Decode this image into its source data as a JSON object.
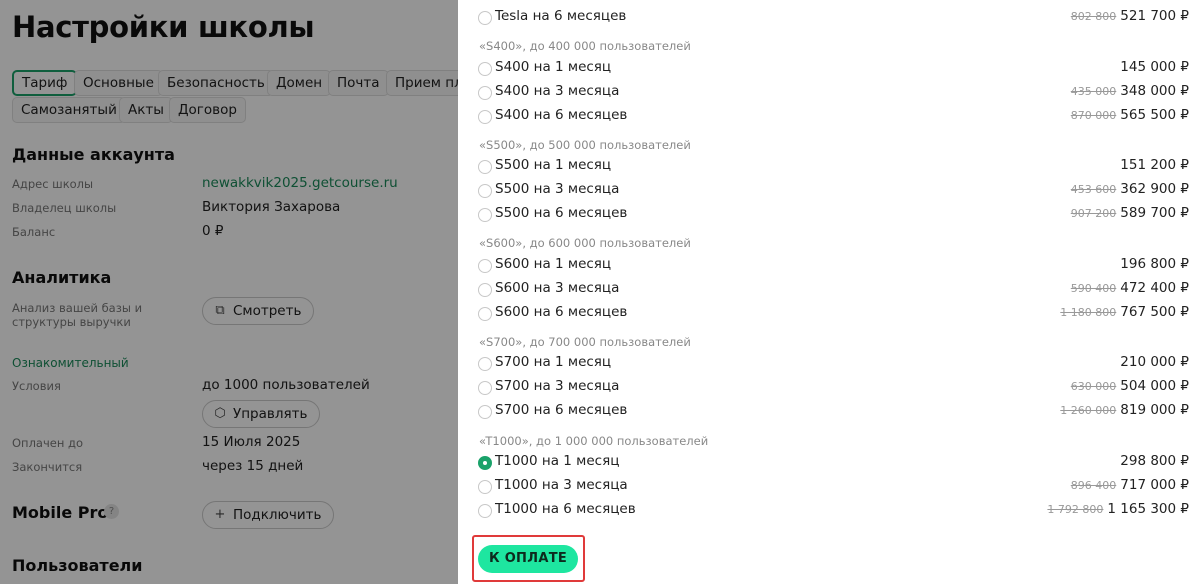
{
  "settings": {
    "title": "Настройки школы",
    "tabs": [
      "Тариф",
      "Основные",
      "Безопасность",
      "Домен",
      "Почта",
      "Прием пл",
      "Самозанятый",
      "Акты",
      "Договор"
    ],
    "account": {
      "title": "Данные аккаунта",
      "school_address_label": "Адрес школы",
      "school_address": "newakkvik2025.getcourse.ru",
      "owner_label": "Владелец школы",
      "owner": "Виктория Захарова",
      "balance_label": "Баланс",
      "balance": "0 ₽"
    },
    "analytics": {
      "title": "Аналитика",
      "desc_line1": "Анализ вашей базы и",
      "desc_line2": "структуры выручки",
      "view_button": "Смотреть"
    },
    "plan": {
      "name": "Ознакомительный",
      "conditions_label": "Условия",
      "conditions": "до 1000 пользователей",
      "manage_button": "Управлять",
      "paid_until_label": "Оплачен до",
      "paid_until": "15 Июля 2025",
      "ends_label": "Закончится",
      "ends": "через 15 дней"
    },
    "mobile": {
      "title": "Mobile Pro",
      "help_icon": "?",
      "connect_button": "Подключить"
    },
    "users": {
      "title": "Пользователи"
    }
  },
  "tariffs": {
    "top_row": {
      "name": "Tesla на 6 месяцев",
      "old_price": "802 800",
      "price": "521 700 ₽"
    },
    "groups": [
      {
        "title": "«S400», до 400 000 пользователей",
        "rows": [
          {
            "name": "S400 на 1 месяц",
            "old_price": "",
            "price": "145 000 ₽"
          },
          {
            "name": "S400 на 3 месяца",
            "old_price": "435 000",
            "price": "348 000 ₽"
          },
          {
            "name": "S400 на 6 месяцев",
            "old_price": "870 000",
            "price": "565 500 ₽"
          }
        ]
      },
      {
        "title": "«S500», до 500 000 пользователей",
        "rows": [
          {
            "name": "S500 на 1 месяц",
            "old_price": "",
            "price": "151 200 ₽"
          },
          {
            "name": "S500 на 3 месяца",
            "old_price": "453 600",
            "price": "362 900 ₽"
          },
          {
            "name": "S500 на 6 месяцев",
            "old_price": "907 200",
            "price": "589 700 ₽"
          }
        ]
      },
      {
        "title": "«S600», до 600 000 пользователей",
        "rows": [
          {
            "name": "S600 на 1 месяц",
            "old_price": "",
            "price": "196 800 ₽"
          },
          {
            "name": "S600 на 3 месяца",
            "old_price": "590 400",
            "price": "472 400 ₽"
          },
          {
            "name": "S600 на 6 месяцев",
            "old_price": "1 180 800",
            "price": "767 500 ₽"
          }
        ]
      },
      {
        "title": "«S700», до 700 000 пользователей",
        "rows": [
          {
            "name": "S700 на 1 месяц",
            "old_price": "",
            "price": "210 000 ₽"
          },
          {
            "name": "S700 на 3 месяца",
            "old_price": "630 000",
            "price": "504 000 ₽"
          },
          {
            "name": "S700 на 6 месяцев",
            "old_price": "1 260 000",
            "price": "819 000 ₽"
          }
        ]
      },
      {
        "title": "«T1000», до 1 000 000 пользователей",
        "rows": [
          {
            "name": "T1000 на 1 месяц",
            "old_price": "",
            "price": "298 800 ₽",
            "selected": true
          },
          {
            "name": "T1000 на 3 месяца",
            "old_price": "896 400",
            "price": "717 000 ₽"
          },
          {
            "name": "T1000 на 6 месяцев",
            "old_price": "1 792 800",
            "price": "1 165 300 ₽"
          }
        ]
      }
    ],
    "pay_button": "К ОПЛАТЕ",
    "accent_color": "#1ee6a0",
    "highlight_color": "#e03a3a"
  }
}
